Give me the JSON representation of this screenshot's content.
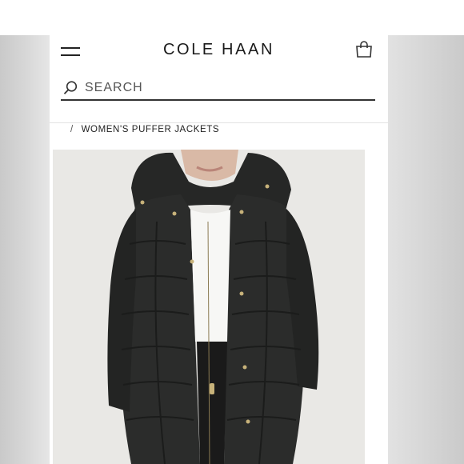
{
  "header": {
    "brand": "COLE HAAN",
    "menu_icon": "hamburger-menu-icon",
    "bag_icon": "shopping-bag-icon"
  },
  "search": {
    "placeholder": "SEARCH",
    "icon": "search-icon"
  },
  "breadcrumb": {
    "separator": "/",
    "current": "WOMEN'S PUFFER JACKETS"
  },
  "product": {
    "image_alt": "Woman wearing a long black hooded puffer jacket",
    "colors": {
      "jacket": "#2a2b2a",
      "background": "#e9e8e5"
    }
  }
}
